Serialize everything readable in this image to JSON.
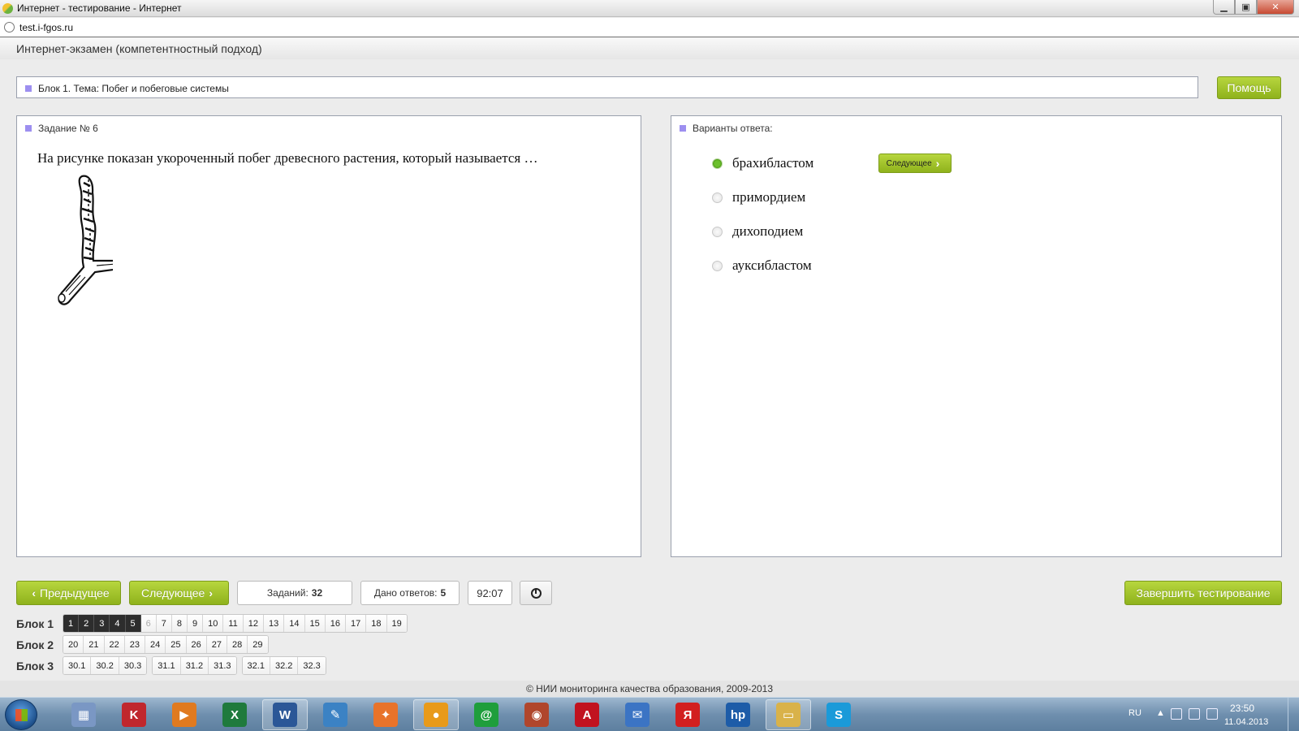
{
  "window": {
    "title": "Интернет - тестирование - Интернет",
    "url": "test.i-fgos.ru",
    "min_glyph": "▁",
    "max_glyph": "▣",
    "close_glyph": "✕"
  },
  "header": {
    "app_title": "Интернет-экзамен (компетентностный подход)"
  },
  "topic": {
    "label": "Блок 1. Тема: Побег и побеговые системы"
  },
  "help_label": "Помощь",
  "task": {
    "label": "Задание № 6",
    "question": "На рисунке показан укороченный побег древесного растения, который называется …"
  },
  "answers": {
    "label": "Варианты ответа:",
    "options": [
      {
        "text": "брахибластом",
        "selected": true
      },
      {
        "text": "примордием",
        "selected": false
      },
      {
        "text": "дихоподием",
        "selected": false
      },
      {
        "text": "ауксибластом",
        "selected": false
      }
    ],
    "next_small_label": "Следующее"
  },
  "nav": {
    "prev_label": "Предыдущее",
    "next_label": "Следующее",
    "tasks_label": "Заданий:",
    "tasks_count": "32",
    "answers_label": "Дано ответов:",
    "answers_count": "5",
    "timer": "92:07",
    "finish_label": "Завершить тестирование"
  },
  "blocks": [
    {
      "label": "Блок 1",
      "groups": [
        [
          "1",
          "2",
          "3",
          "4",
          "5",
          "6",
          "7",
          "8",
          "9",
          "10",
          "11",
          "12",
          "13",
          "14",
          "15",
          "16",
          "17",
          "18",
          "19"
        ]
      ]
    },
    {
      "label": "Блок 2",
      "groups": [
        [
          "20",
          "21",
          "22",
          "23",
          "24",
          "25",
          "26",
          "27",
          "28",
          "29"
        ]
      ]
    },
    {
      "label": "Блок 3",
      "groups": [
        [
          "30.1",
          "30.2",
          "30.3"
        ],
        [
          "31.1",
          "31.2",
          "31.3"
        ],
        [
          "32.1",
          "32.2",
          "32.3"
        ]
      ]
    }
  ],
  "answered_items": [
    "1",
    "2",
    "3",
    "4",
    "5"
  ],
  "current_item": "6",
  "footer": {
    "text": "© НИИ мониторинга качества образования, 2009-2013"
  },
  "taskbar": {
    "icons": [
      {
        "name": "calculator-icon",
        "glyph": "▦",
        "color": "#7a97c4"
      },
      {
        "name": "kaspersky-icon",
        "glyph": "K",
        "color": "#c0272d"
      },
      {
        "name": "media-player-icon",
        "glyph": "▶",
        "color": "#e07a1f"
      },
      {
        "name": "excel-icon",
        "glyph": "X",
        "color": "#1f7a3d"
      },
      {
        "name": "word-icon",
        "glyph": "W",
        "color": "#2b5797"
      },
      {
        "name": "paint-icon",
        "glyph": "✎",
        "color": "#3b82c4"
      },
      {
        "name": "app-orange-icon",
        "glyph": "✦",
        "color": "#e8732a"
      },
      {
        "name": "browser-app-icon",
        "glyph": "●",
        "color": "#e89a1a"
      },
      {
        "name": "mail-agent-icon",
        "glyph": "@",
        "color": "#1f9e3c"
      },
      {
        "name": "globe-app-icon",
        "glyph": "◉",
        "color": "#b0462c"
      },
      {
        "name": "acrobat-icon",
        "glyph": "A",
        "color": "#c1121f"
      },
      {
        "name": "mail-icon",
        "glyph": "✉",
        "color": "#3b74c4"
      },
      {
        "name": "yandex-icon",
        "glyph": "Я",
        "color": "#d21f1f"
      },
      {
        "name": "hp-icon",
        "glyph": "hp",
        "color": "#1d5ca8"
      },
      {
        "name": "explorer-folder-icon",
        "glyph": "▭",
        "color": "#d9b24a"
      },
      {
        "name": "skype-icon",
        "glyph": "S",
        "color": "#1a9ad9"
      }
    ],
    "active_indices": [
      4,
      7,
      14
    ],
    "lang": "RU",
    "time": "23:50",
    "date": "11.04.2013"
  }
}
